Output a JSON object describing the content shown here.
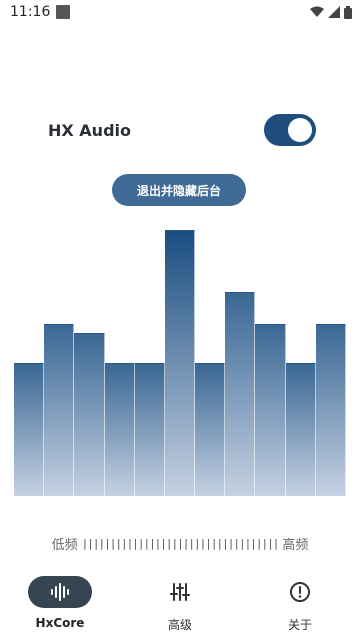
{
  "status": {
    "time": "11:16"
  },
  "header": {
    "title": "HX Audio",
    "toggle_on": true
  },
  "exit_button": {
    "label": "退出并隐藏后台"
  },
  "equalizer": {
    "levels": [
      0.45,
      0.58,
      0.55,
      0.45,
      0.45,
      0.9,
      0.45,
      0.69,
      0.58,
      0.45,
      0.58
    ],
    "low_label": "低频",
    "high_label": "高频",
    "ticks": "|||||||||||||||||||||||||||||||||||"
  },
  "nav": {
    "items": [
      {
        "label": "HxCore",
        "icon": "waveform-icon",
        "active": true
      },
      {
        "label": "高级",
        "icon": "sliders-icon",
        "active": false
      },
      {
        "label": "关于",
        "icon": "info-icon",
        "active": false
      }
    ]
  },
  "colors": {
    "accent": "#1f4d7d",
    "bar_top": "#3a6794",
    "bar_bottom": "#c5d1e2"
  }
}
